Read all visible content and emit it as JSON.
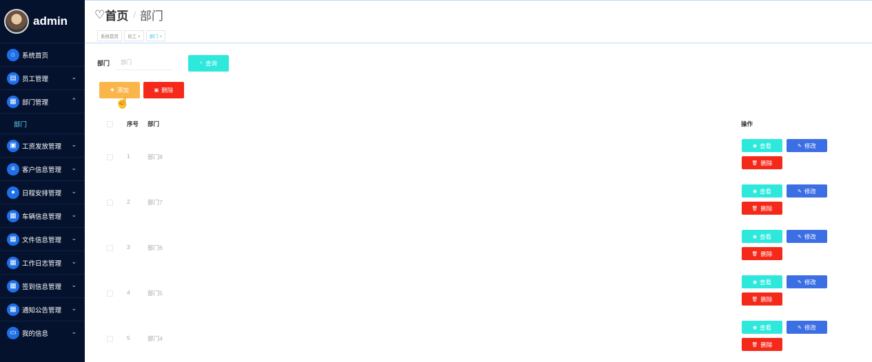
{
  "brand": {
    "name": "admin"
  },
  "sidebar": {
    "items": [
      {
        "label": "系统首页",
        "icon": "home-icon",
        "glyph": "⌂",
        "chevron": ""
      },
      {
        "label": "员工管理",
        "icon": "card-icon",
        "glyph": "▤",
        "chevron": "⌄"
      },
      {
        "label": "部门管理",
        "icon": "grid-icon",
        "glyph": "▦",
        "chevron": "⌃"
      },
      {
        "label": "工资发放管理",
        "icon": "clipboard-icon",
        "glyph": "▣",
        "chevron": "⌄"
      },
      {
        "label": "客户信息管理",
        "icon": "list-icon",
        "glyph": "≡",
        "chevron": "⌄"
      },
      {
        "label": "日程安排管理",
        "icon": "pin-icon",
        "glyph": "●",
        "chevron": "⌄"
      },
      {
        "label": "车辆信息管理",
        "icon": "grid-icon",
        "glyph": "▦",
        "chevron": "⌄"
      },
      {
        "label": "文件信息管理",
        "icon": "grid-icon",
        "glyph": "▦",
        "chevron": "⌄"
      },
      {
        "label": "工作日志管理",
        "icon": "grid-icon",
        "glyph": "▦",
        "chevron": "⌄"
      },
      {
        "label": "签到信息管理",
        "icon": "grid-icon",
        "glyph": "▦",
        "chevron": "⌄"
      },
      {
        "label": "通知公告管理",
        "icon": "grid-icon",
        "glyph": "▦",
        "chevron": "⌄"
      },
      {
        "label": "我的信息",
        "icon": "window-icon",
        "glyph": "▭",
        "chevron": "⌄"
      }
    ],
    "submenu": {
      "label": "部门"
    }
  },
  "header": {
    "heart": "♡",
    "home": "首页",
    "sep": "/",
    "current": "部门"
  },
  "tabs": [
    {
      "label": "系统首页",
      "active": false
    },
    {
      "label": "员工 ×",
      "active": false
    },
    {
      "label": "部门 ×",
      "active": true
    }
  ],
  "search": {
    "label": "部门",
    "placeholder": "部门",
    "button": "查询",
    "button_icon": "⌕"
  },
  "toolbar": {
    "add": "添加",
    "add_icon": "✚",
    "delete": "删除",
    "delete_icon": "▣"
  },
  "cursor": "☝",
  "table": {
    "headers": {
      "index": "序号",
      "name": "部门",
      "action": "操作"
    },
    "rows": [
      {
        "index": "1",
        "name": "部门8"
      },
      {
        "index": "2",
        "name": "部门7"
      },
      {
        "index": "3",
        "name": "部门6"
      },
      {
        "index": "4",
        "name": "部门5"
      },
      {
        "index": "5",
        "name": "部门4"
      }
    ],
    "actions": {
      "view": "查看",
      "view_icon": "◉",
      "edit": "修改",
      "edit_icon": "✎",
      "delete": "删除",
      "delete_icon": "🗑"
    }
  },
  "colors": {
    "sidebar": "#04122e",
    "cyan": "#2ee8dc",
    "blue": "#3c6fe4",
    "red": "#f5291a",
    "orange": "#fbb64b"
  }
}
